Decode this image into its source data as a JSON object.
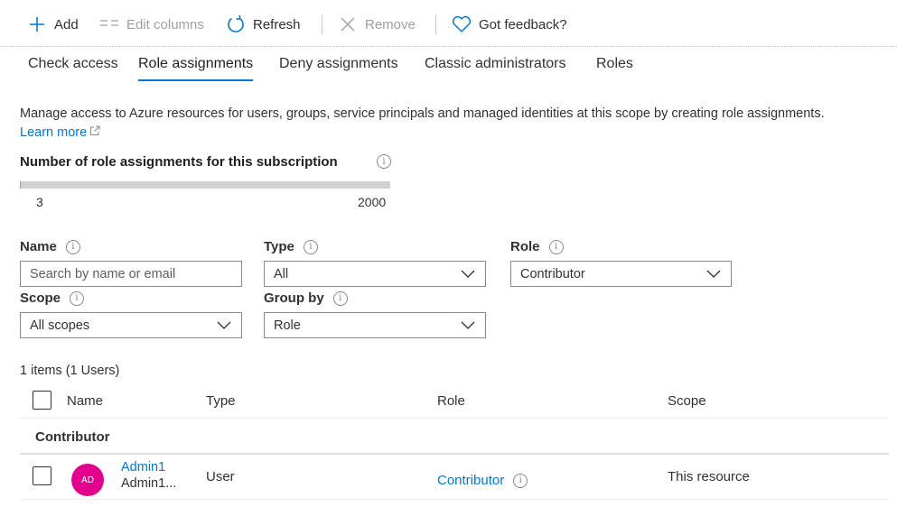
{
  "toolbar": {
    "add": "Add",
    "edit_columns": "Edit columns",
    "refresh": "Refresh",
    "remove": "Remove",
    "feedback": "Got feedback?"
  },
  "tabs": [
    {
      "label": "Check access",
      "active": false
    },
    {
      "label": "Role assignments",
      "active": true
    },
    {
      "label": "Deny assignments",
      "active": false
    },
    {
      "label": "Classic administrators",
      "active": false
    },
    {
      "label": "Roles",
      "active": false
    }
  ],
  "description": {
    "text": "Manage access to Azure resources for users, groups, service principals and managed identities at this scope by creating role assignments.",
    "learn_more": "Learn more"
  },
  "assignment_count": {
    "title": "Number of role assignments for this subscription",
    "current": "3",
    "max": "2000",
    "fraction": 0.0015
  },
  "filters": {
    "name": {
      "label": "Name",
      "placeholder": "Search by name or email"
    },
    "type": {
      "label": "Type",
      "value": "All"
    },
    "role": {
      "label": "Role",
      "value": "Contributor"
    },
    "scope": {
      "label": "Scope",
      "value": "All scopes"
    },
    "group_by": {
      "label": "Group by",
      "value": "Role"
    }
  },
  "table": {
    "items_count": "1 items (1 Users)",
    "columns": {
      "name": "Name",
      "type": "Type",
      "role": "Role",
      "scope": "Scope"
    },
    "groups": [
      {
        "label": "Contributor",
        "rows": [
          {
            "initials": "AD",
            "name": "Admin1",
            "sub": "Admin1...",
            "type": "User",
            "role": "Contributor",
            "scope": "This resource"
          }
        ]
      }
    ]
  },
  "colors": {
    "accent": "#0078d4",
    "avatar": "#e3008c"
  }
}
